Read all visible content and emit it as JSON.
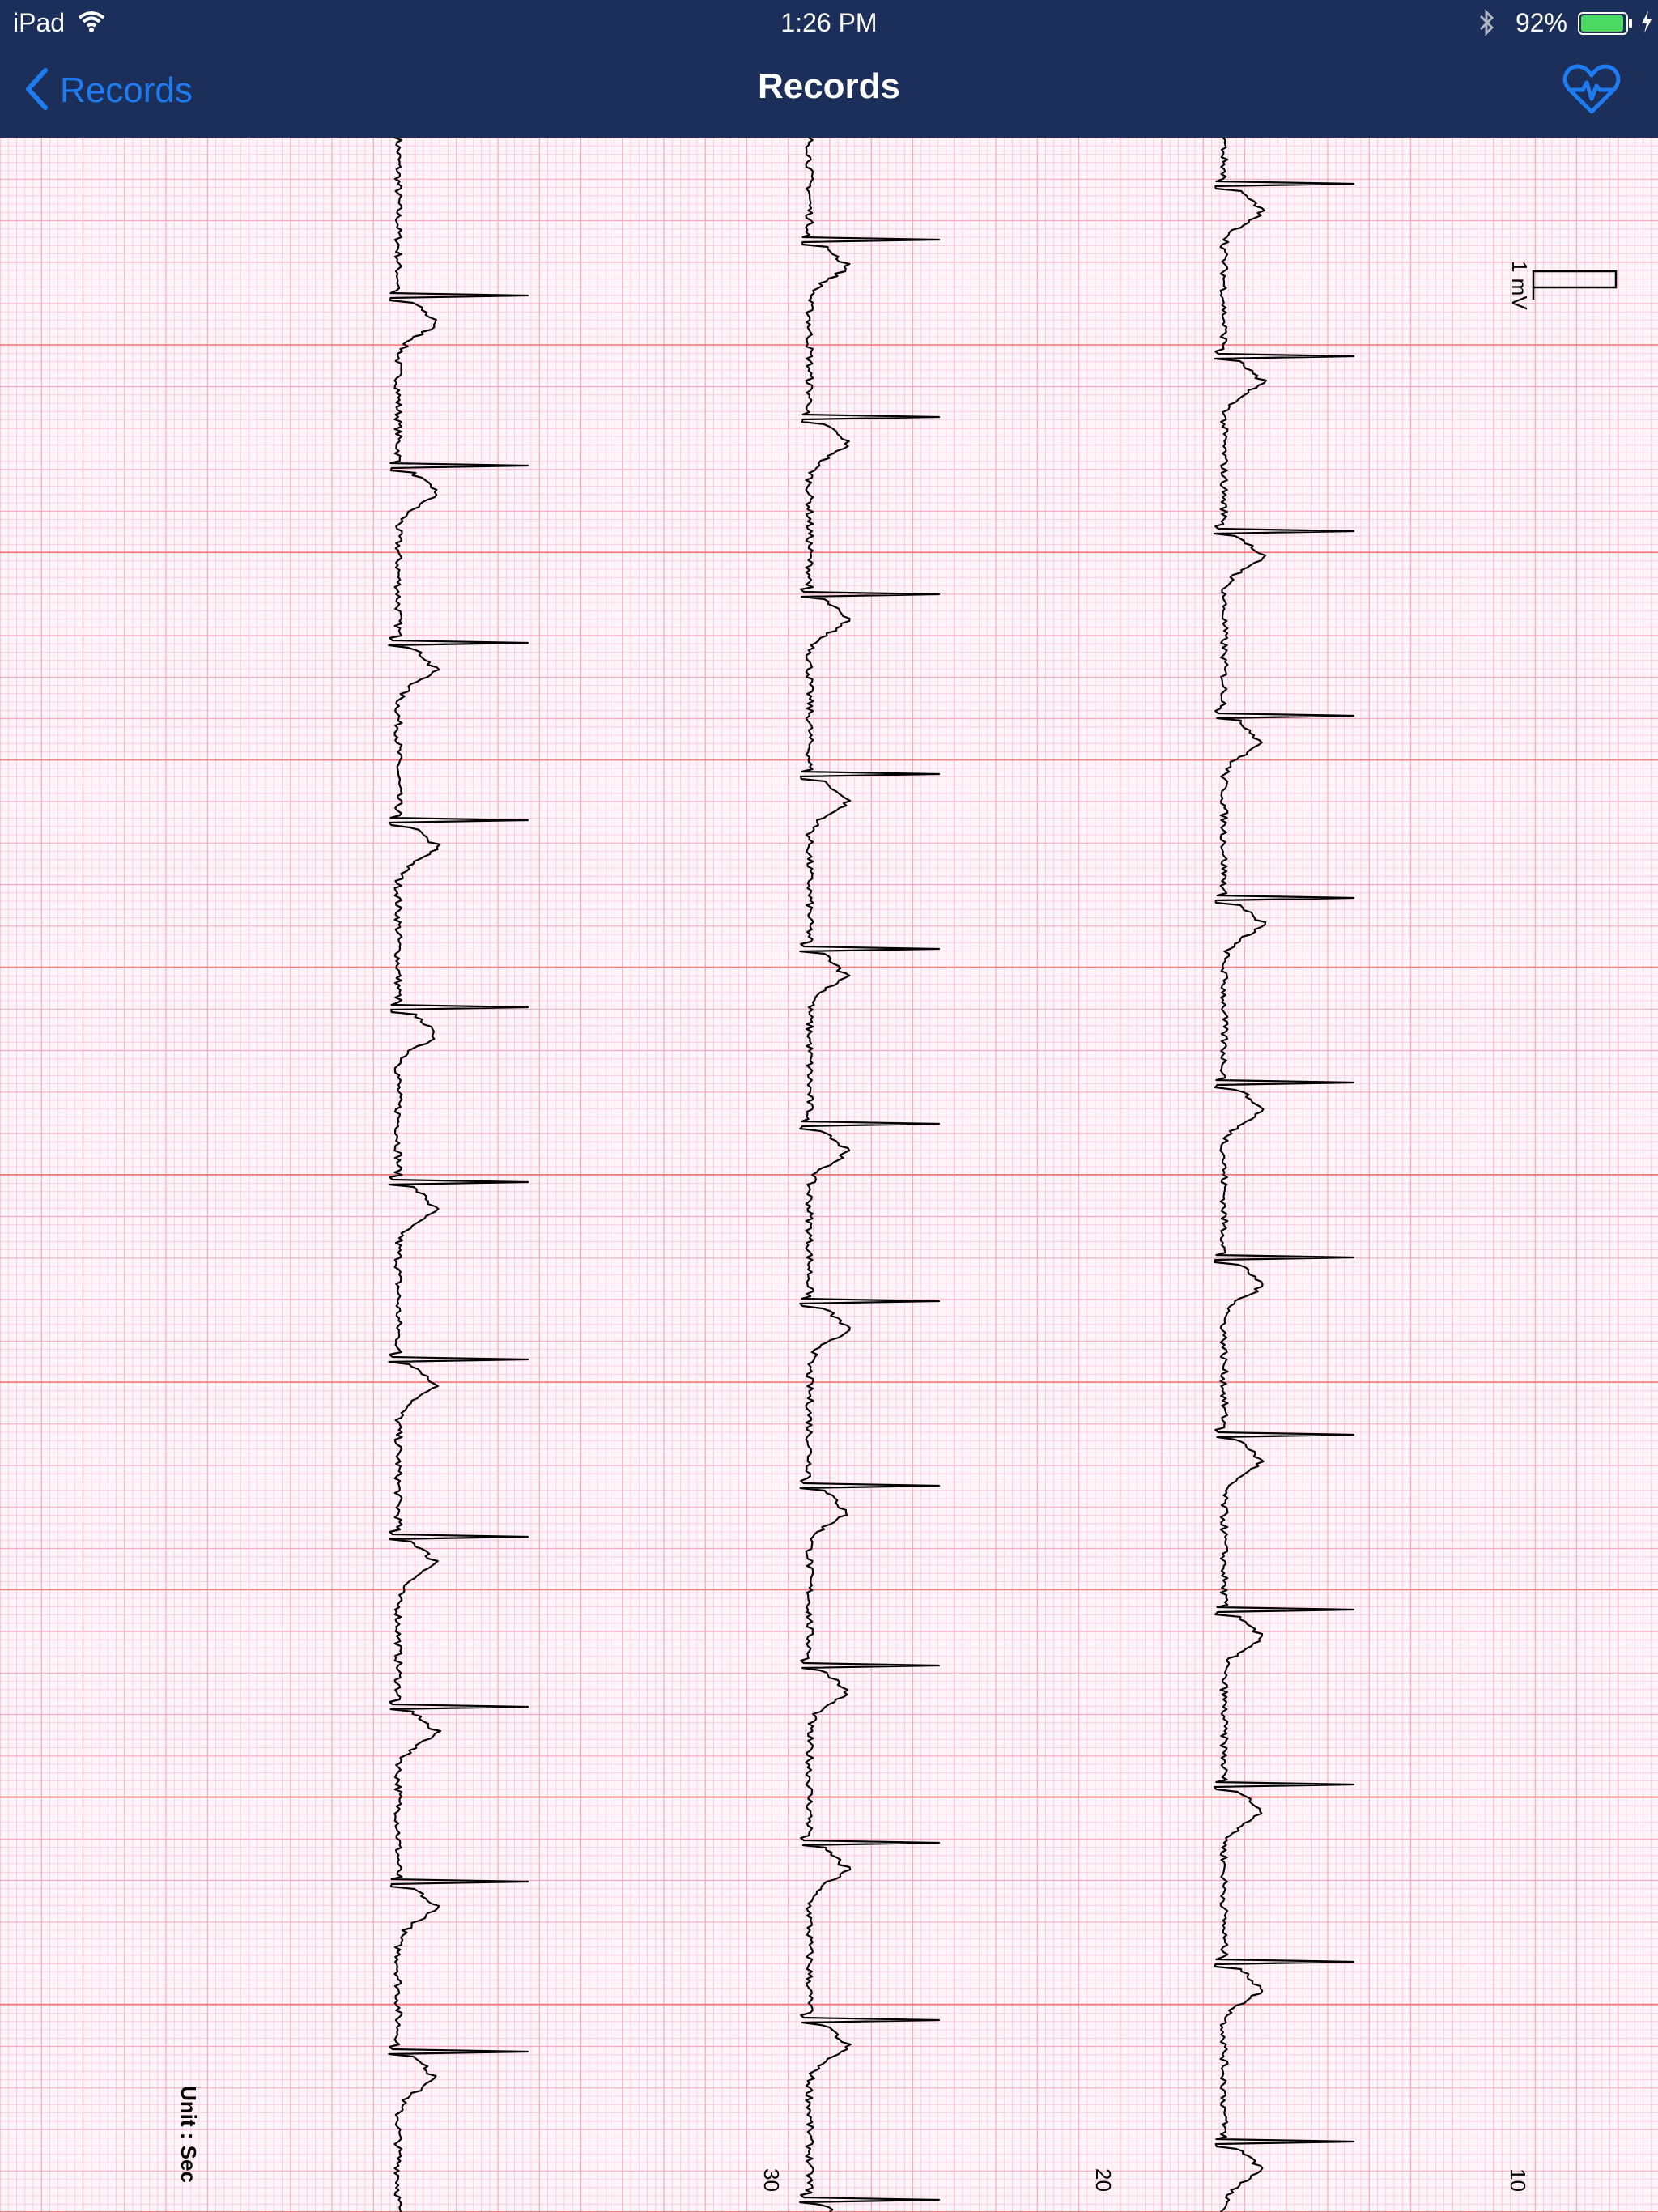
{
  "status_bar": {
    "device": "iPad",
    "time": "1:26 PM",
    "battery_percent": "92%"
  },
  "nav": {
    "back_label": "Records",
    "title": "Records"
  },
  "ecg": {
    "calibration_label": "1 mV",
    "unit_label": "Unit : Sec",
    "time_marks": [
      "30",
      "20",
      "10"
    ],
    "grid_colors": {
      "minor": "#f7c6dc",
      "major": "#f27a7a",
      "background": "#fff4f8"
    },
    "trace_color": "#000000"
  }
}
